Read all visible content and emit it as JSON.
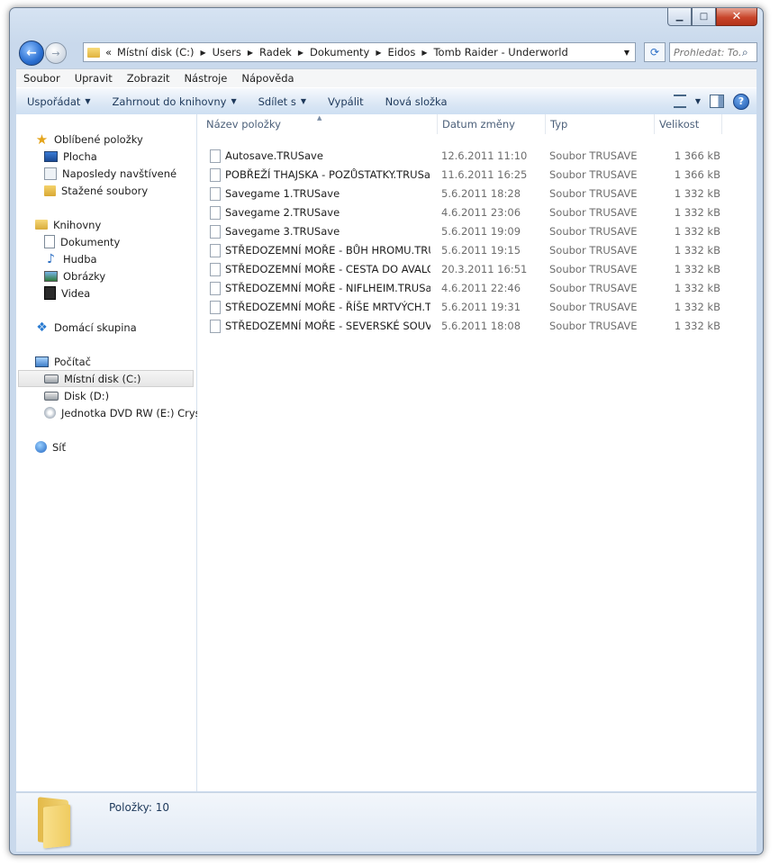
{
  "address": {
    "overflow": "«",
    "crumbs": [
      "Místní disk (C:)",
      "Users",
      "Radek",
      "Dokumenty",
      "Eidos",
      "Tomb Raider - Underworld"
    ]
  },
  "search": {
    "placeholder": "Prohledat: To..."
  },
  "menu": [
    "Soubor",
    "Upravit",
    "Zobrazit",
    "Nástroje",
    "Nápověda"
  ],
  "commands": {
    "organize": "Uspořádat",
    "include": "Zahrnout do knihovny",
    "share": "Sdílet s",
    "burn": "Vypálit",
    "new_folder": "Nová složka"
  },
  "sidebar": {
    "favorites": {
      "title": "Oblíbené položky",
      "items": [
        "Plocha",
        "Naposledy navštívené",
        "Stažené soubory"
      ]
    },
    "libraries": {
      "title": "Knihovny",
      "items": [
        "Dokumenty",
        "Hudba",
        "Obrázky",
        "Videa"
      ]
    },
    "homegroup": {
      "title": "Domácí skupina"
    },
    "computer": {
      "title": "Počítač",
      "items": [
        "Místní disk (C:)",
        "Disk (D:)",
        "Jednotka DVD RW (E:) Crysis"
      ],
      "selected": "Místní disk (C:)"
    },
    "network": {
      "title": "Síť"
    }
  },
  "columns": {
    "name": "Název položky",
    "date": "Datum změny",
    "type": "Typ",
    "size": "Velikost"
  },
  "files": [
    {
      "name": "Autosave.TRUSave",
      "date": "12.6.2011 11:10",
      "type": "Soubor TRUSAVE",
      "size": "1 366 kB"
    },
    {
      "name": "POBŘEŽÍ THAJSKA - POZŮSTATKY.TRUSave",
      "date": "11.6.2011 16:25",
      "type": "Soubor TRUSAVE",
      "size": "1 366 kB"
    },
    {
      "name": "Savegame 1.TRUSave",
      "date": "5.6.2011 18:28",
      "type": "Soubor TRUSAVE",
      "size": "1 332 kB"
    },
    {
      "name": "Savegame 2.TRUSave",
      "date": "4.6.2011 23:06",
      "type": "Soubor TRUSAVE",
      "size": "1 332 kB"
    },
    {
      "name": "Savegame 3.TRUSave",
      "date": "5.6.2011 19:09",
      "type": "Soubor TRUSAVE",
      "size": "1 332 kB"
    },
    {
      "name": "STŘEDOZEMNÍ MOŘE - BŮH HROMU.TRUS...",
      "date": "5.6.2011 19:15",
      "type": "Soubor TRUSAVE",
      "size": "1 332 kB"
    },
    {
      "name": "STŘEDOZEMNÍ MOŘE - CESTA DO AVALON...",
      "date": "20.3.2011 16:51",
      "type": "Soubor TRUSAVE",
      "size": "1 332 kB"
    },
    {
      "name": "STŘEDOZEMNÍ MOŘE - NIFLHEIM.TRUSave",
      "date": "4.6.2011 22:46",
      "type": "Soubor TRUSAVE",
      "size": "1 332 kB"
    },
    {
      "name": "STŘEDOZEMNÍ MOŘE - ŘÍŠE MRTVÝCH.TRU...",
      "date": "5.6.2011 19:31",
      "type": "Soubor TRUSAVE",
      "size": "1 332 kB"
    },
    {
      "name": "STŘEDOZEMNÍ MOŘE - SEVERSKÉ SOUVISL...",
      "date": "5.6.2011 18:08",
      "type": "Soubor TRUSAVE",
      "size": "1 332 kB"
    }
  ],
  "details": {
    "items_count": "Položky: 10"
  }
}
